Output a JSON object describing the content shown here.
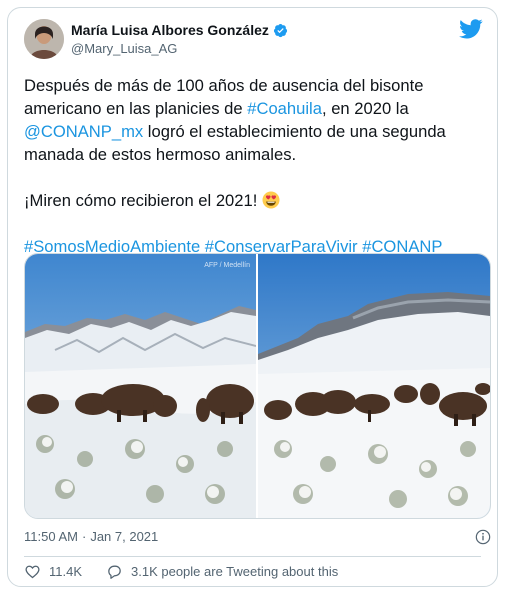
{
  "author": {
    "display_name": "María Luisa Albores González",
    "handle": "@Mary_Luisa_AG",
    "verified": true
  },
  "tweet": {
    "line1_text": "Después de más de 100 años de ausencia del bisonte americano en las planicies de ",
    "line1_hashtag": "#Coahuila",
    "line1_tail": ", en 2020 la ",
    "mention": "@CONANP_mx",
    "line1_end": " logró el establecimiento de una segunda manada de estos hermoso animales.",
    "line2_text": "¡Miren cómo recibieron el 2021! ",
    "line2_emoji": "heart-eyes-emoji",
    "hashtags": [
      "#SomosMedioAmbiente",
      "#ConservarParaVivir",
      "#CONANP"
    ]
  },
  "media": {
    "photos": [
      {
        "name": "snowy-bison-photo-1",
        "watermark": "AFP / Medellín"
      },
      {
        "name": "snowy-bison-photo-2"
      }
    ]
  },
  "meta": {
    "time": "11:50 AM",
    "separator": "·",
    "date": "Jan 7, 2021"
  },
  "actions": {
    "likes": "11.4K",
    "tweeting_about": "3.1K people are Tweeting about this"
  },
  "colors": {
    "link": "#1b95e0",
    "twitter_blue": "#1d9bf0",
    "border": "#cfd9de",
    "muted": "#536471"
  },
  "icons": {
    "logo": "twitter-bird-icon",
    "verified": "verified-badge-icon",
    "info": "info-icon",
    "like": "heart-icon",
    "comment": "speech-bubble-icon"
  }
}
